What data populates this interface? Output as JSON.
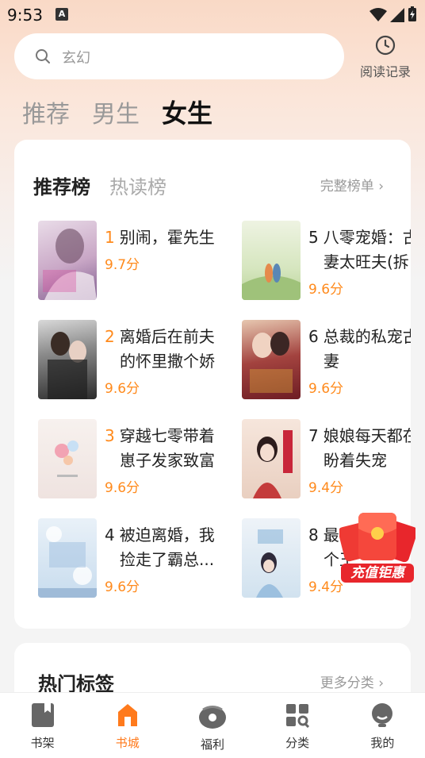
{
  "status_bar": {
    "time": "9:53",
    "badge": "A"
  },
  "search": {
    "placeholder": "玄幻"
  },
  "history": {
    "label": "阅读记录"
  },
  "gender_tabs": [
    {
      "label": "推荐",
      "active": false
    },
    {
      "label": "男生",
      "active": false
    },
    {
      "label": "女生",
      "active": true
    }
  ],
  "ranking": {
    "tabs": [
      {
        "label": "推荐榜",
        "active": true
      },
      {
        "label": "热读榜",
        "active": false
      }
    ],
    "full_link": "完整榜单 ›",
    "items": [
      {
        "rank": "1",
        "title_lines": [
          "别闹，霍先生"
        ],
        "score": "9.7分"
      },
      {
        "rank": "2",
        "title_lines": [
          "离婚后在前夫",
          "的怀里撒个娇"
        ],
        "score": "9.6分"
      },
      {
        "rank": "3",
        "title_lines": [
          "穿越七零带着",
          "崽子发家致富"
        ],
        "score": "9.6分"
      },
      {
        "rank": "4",
        "title_lines": [
          "被迫离婚，我",
          "捡走了霸总..."
        ],
        "score": "9.6分"
      },
      {
        "rank": "5",
        "title_lines": [
          "八零宠婚：古",
          "妻太旺夫(拆"
        ],
        "score": "9.6分"
      },
      {
        "rank": "6",
        "title_lines": [
          "总裁的私宠古",
          "妻"
        ],
        "score": "9.6分"
      },
      {
        "rank": "7",
        "title_lines": [
          "娘娘每天都在",
          "盼着失宠"
        ],
        "score": "9.4分"
      },
      {
        "rank": "8",
        "title_lines": [
          "最强",
          "个王"
        ],
        "score": "9.4分"
      }
    ]
  },
  "tags_section": {
    "title": "热门标签",
    "more": "更多分类 ›"
  },
  "promo": {
    "label": "充值钜惠"
  },
  "bottom_nav": [
    {
      "label": "书架",
      "icon": "bookshelf-icon",
      "active": false
    },
    {
      "label": "书城",
      "icon": "bookstore-icon",
      "active": true
    },
    {
      "label": "福利",
      "icon": "gift-bag-icon",
      "active": false
    },
    {
      "label": "分类",
      "icon": "category-icon",
      "active": false
    },
    {
      "label": "我的",
      "icon": "profile-icon",
      "active": false
    }
  ],
  "colors": {
    "accent": "#ff8a1c",
    "nav_active": "#ff7a1c",
    "promo_red": "#e8262c"
  }
}
